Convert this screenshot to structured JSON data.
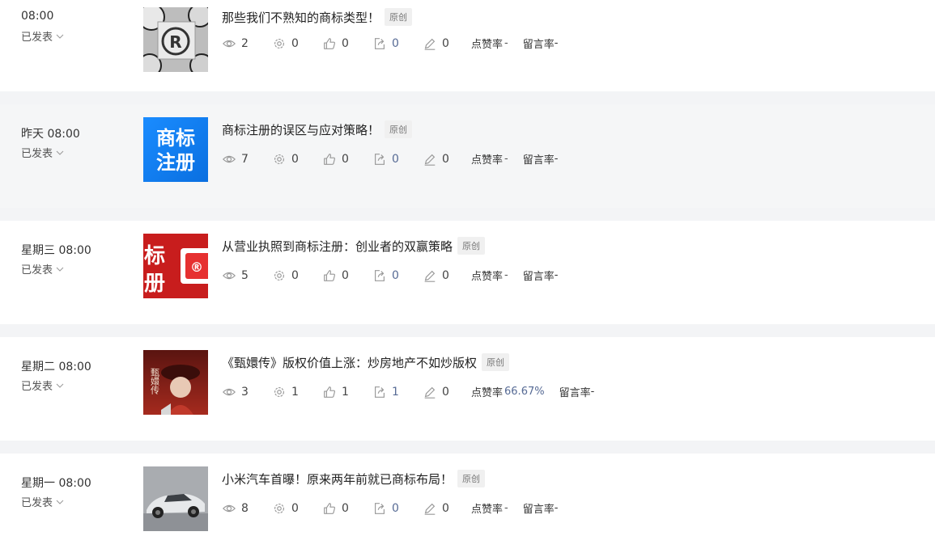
{
  "articles": [
    {
      "time": "08:00",
      "status": "已发表",
      "title": "那些我们不熟知的商标类型！",
      "badge": "原创",
      "reads": "2",
      "settings": "0",
      "likes": "0",
      "shares": "0",
      "comments": "0",
      "like_rate_label": "点赞率",
      "like_rate": "-",
      "comment_rate_label": "留言率",
      "comment_rate": "-"
    },
    {
      "time": "昨天 08:00",
      "status": "已发表",
      "title": "商标注册的误区与应对策略！",
      "badge": "原创",
      "reads": "7",
      "settings": "0",
      "likes": "0",
      "shares": "0",
      "comments": "0",
      "like_rate_label": "点赞率",
      "like_rate": "-",
      "comment_rate_label": "留言率",
      "comment_rate": "-",
      "thumb_text": "商标\n注册"
    },
    {
      "time": "星期三 08:00",
      "status": "已发表",
      "title": "从营业执照到商标注册：创业者的双赢策略",
      "badge": "原创",
      "reads": "5",
      "settings": "0",
      "likes": "0",
      "shares": "0",
      "comments": "0",
      "like_rate_label": "点赞率",
      "like_rate": "-",
      "comment_rate_label": "留言率",
      "comment_rate": "-"
    },
    {
      "time": "星期二 08:00",
      "status": "已发表",
      "title": "《甄嬛传》版权价值上涨：炒房地产不如炒版权",
      "badge": "原创",
      "reads": "3",
      "settings": "1",
      "likes": "1",
      "shares": "1",
      "comments": "0",
      "like_rate_label": "点赞率",
      "like_rate": "66.67%",
      "comment_rate_label": "留言率",
      "comment_rate": "-"
    },
    {
      "time": "星期一 08:00",
      "status": "已发表",
      "title": "小米汽车首曝！原来两年前就已商标布局！",
      "badge": "原创",
      "reads": "8",
      "settings": "0",
      "likes": "0",
      "shares": "0",
      "comments": "0",
      "like_rate_label": "点赞率",
      "like_rate": "-",
      "comment_rate_label": "留言率",
      "comment_rate": "-"
    }
  ],
  "thumb_labels": {
    "a2_line1": "商标",
    "a2_line2": "注册",
    "a3_text1": "标",
    "a3_text2": "册",
    "a4_text": "甄嬛传"
  },
  "colors": {
    "accent": "#576b95",
    "bg": "#f3f4f6"
  }
}
